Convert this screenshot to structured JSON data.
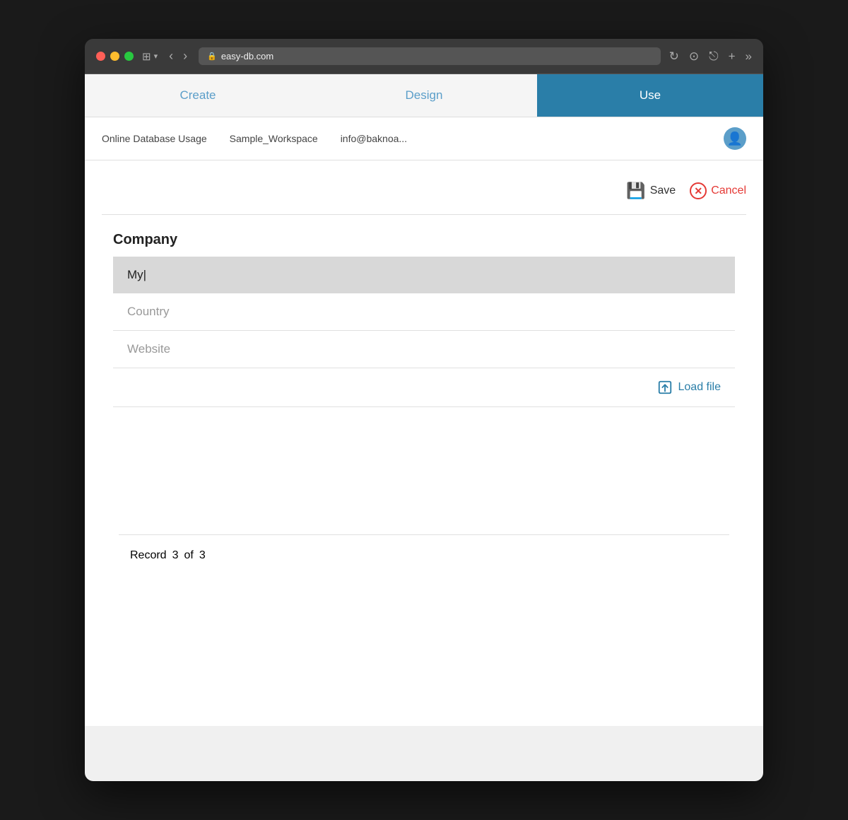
{
  "browser": {
    "url": "easy-db.com",
    "lock_icon": "🔒"
  },
  "tabs": [
    {
      "id": "create",
      "label": "Create",
      "active": false
    },
    {
      "id": "design",
      "label": "Design",
      "active": false
    },
    {
      "id": "use",
      "label": "Use",
      "active": true
    }
  ],
  "header": {
    "workspace_label": "Online Database Usage",
    "workspace_name": "Sample_Workspace",
    "user_email": "info@baknoa...",
    "avatar_icon": "👤"
  },
  "toolbar": {
    "save_label": "Save",
    "cancel_label": "Cancel"
  },
  "form": {
    "company_label": "Company",
    "company_value": "My|",
    "country_placeholder": "Country",
    "website_placeholder": "Website",
    "load_file_label": "Load file"
  },
  "record": {
    "label": "Record",
    "current": "3",
    "of_label": "of",
    "total": "3"
  }
}
